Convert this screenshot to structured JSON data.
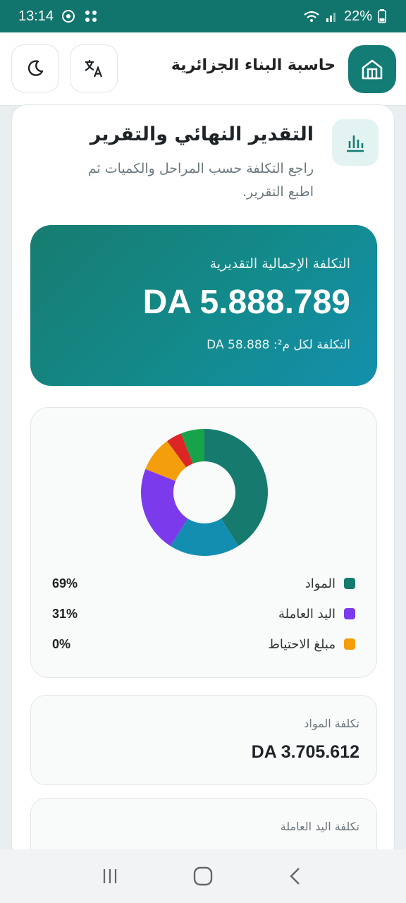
{
  "status_bar": {
    "time": "13:14",
    "battery": "22%"
  },
  "header": {
    "title": "حاسبة البناء الجزائرية",
    "icons": {
      "theme": "moon-icon",
      "language": "translate-icon",
      "home": "home-icon"
    }
  },
  "section": {
    "title": "التقدير النهائي والتقرير",
    "subtitle": "راجع التكلفة حسب المراحل والكميات ثم اطبع التقرير.",
    "icon": "bar-chart-icon"
  },
  "total": {
    "label": "التكلفة الإجمالية التقديرية",
    "value": "DA 5.888.789",
    "per_m2": "التكلفة لكل م²: 58.888 DA"
  },
  "chart_data": {
    "type": "pie",
    "style": "donut",
    "slices": [
      {
        "value": 41,
        "color": "#177a6e"
      },
      {
        "value": 18,
        "color": "#138eb1"
      },
      {
        "value": 22,
        "color": "#7c3aed"
      },
      {
        "value": 9,
        "color": "#f59e0b"
      },
      {
        "value": 4,
        "color": "#dc2626"
      },
      {
        "value": 6,
        "color": "#16a34a"
      }
    ],
    "legend": [
      {
        "label": "المواد",
        "pct": "69%",
        "color": "#177a6e"
      },
      {
        "label": "اليد العاملة",
        "pct": "31%",
        "color": "#7c3aed"
      },
      {
        "label": "مبلغ الاحتياط",
        "pct": "0%",
        "color": "#f59e0b"
      }
    ]
  },
  "costs": [
    {
      "label": "تكلفة المواد",
      "value": "DA 3.705.612"
    },
    {
      "label": "تكلفة اليد العاملة",
      "value": ""
    }
  ],
  "nav": {
    "icons": [
      "recents-icon",
      "home-circle-icon",
      "back-icon"
    ]
  }
}
